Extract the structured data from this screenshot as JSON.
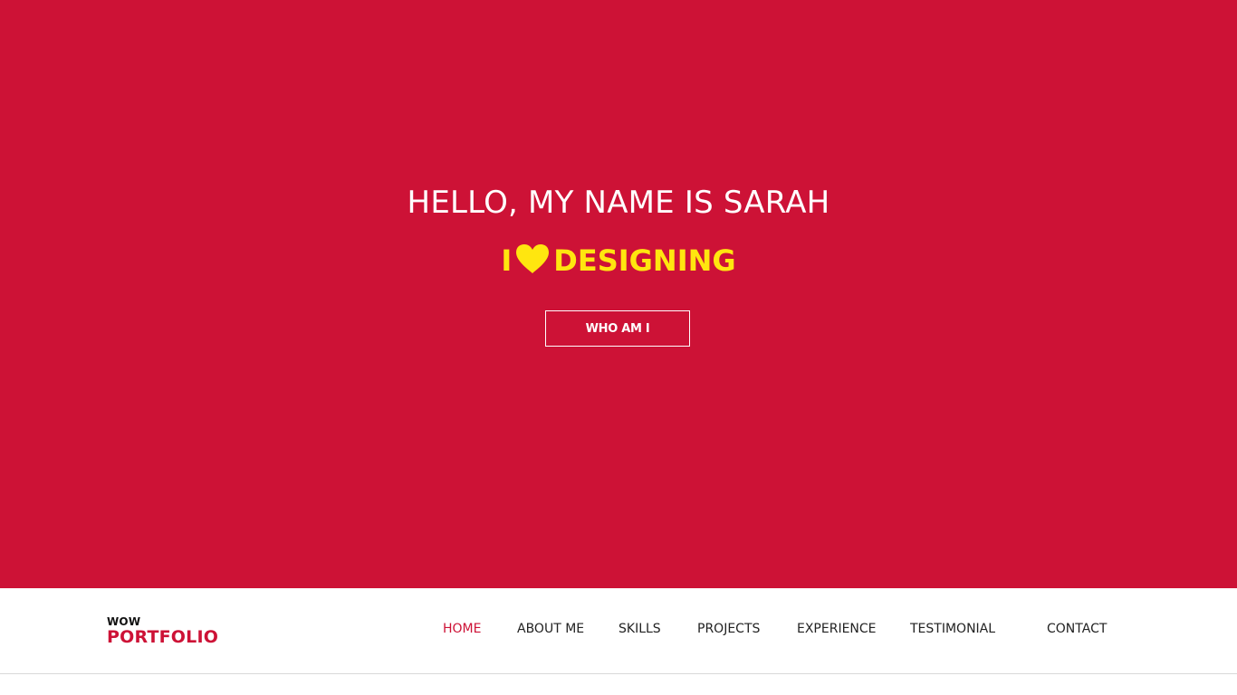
{
  "hero": {
    "greeting": "HELLO, MY NAME IS SARAH",
    "tagline_prefix": "I",
    "tagline_suffix": "DESIGNING",
    "tagline_icon": "heart-icon",
    "button_label": "WHO AM I",
    "background_color": "#cd1236",
    "tagline_color": "#ffe60f"
  },
  "logo": {
    "small": "WOW",
    "big": "PORTFOLIO",
    "accent_color": "#cd1236"
  },
  "nav": {
    "items": [
      {
        "label": "HOME",
        "active": true
      },
      {
        "label": "ABOUT ME",
        "active": false
      },
      {
        "label": "SKILLS",
        "active": false
      },
      {
        "label": "PROJECTS",
        "active": false
      },
      {
        "label": "EXPERIENCE",
        "active": false
      },
      {
        "label": "TESTIMONIAL",
        "active": false
      },
      {
        "label": "CONTACT",
        "active": false
      }
    ]
  }
}
